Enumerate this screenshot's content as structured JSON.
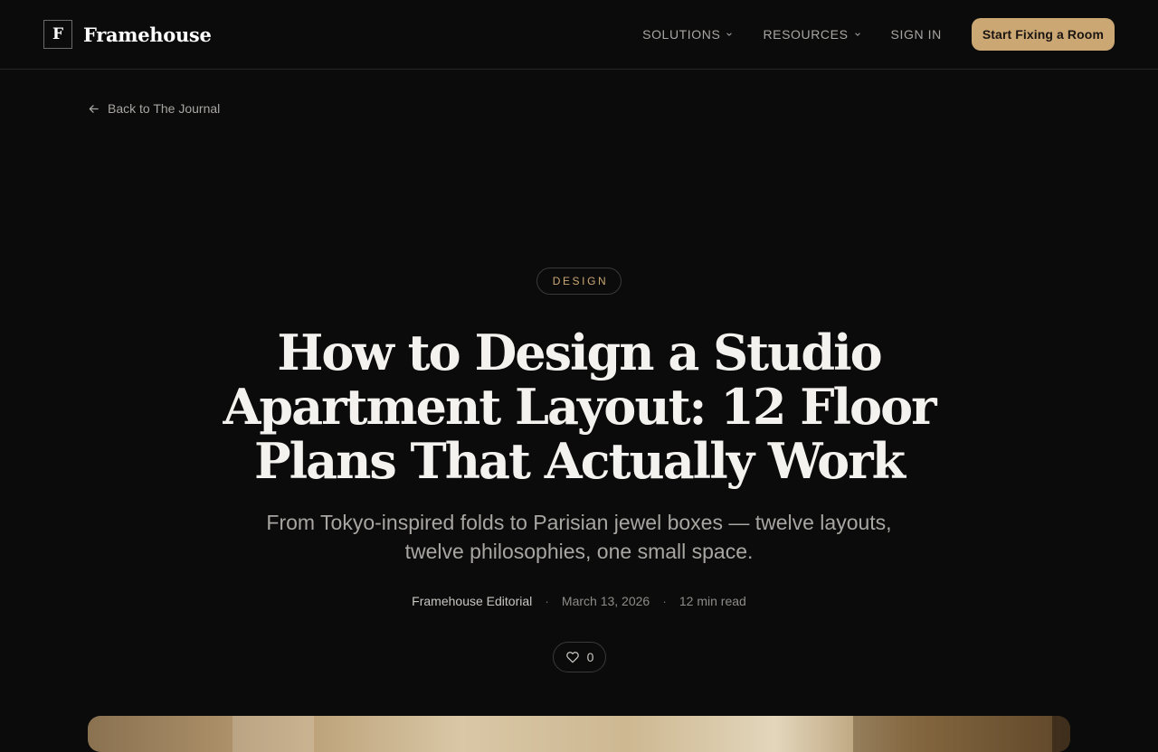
{
  "header": {
    "logo_mark": "F",
    "logo_text": "Framehouse",
    "nav": [
      {
        "label": "SOLUTIONS",
        "has_dropdown": true
      },
      {
        "label": "RESOURCES",
        "has_dropdown": true
      },
      {
        "label": "SIGN IN",
        "has_dropdown": false
      }
    ],
    "cta_label": "Start Fixing a Room"
  },
  "back_link": {
    "label": "Back to The Journal",
    "icon": "arrow-left-icon"
  },
  "article": {
    "category": "DESIGN",
    "title": "How to Design a Studio Apartment Layout: 12 Floor Plans That Actually Work",
    "subtitle": "From Tokyo-inspired folds to Parisian jewel boxes — twelve layouts, twelve philosophies, one small space.",
    "author": "Framehouse Editorial",
    "separator": "·",
    "date": "March 13, 2026",
    "read_time": "12 min read",
    "like_count": "0",
    "like_icon": "heart-icon"
  },
  "colors": {
    "background": "#0b0b0b",
    "accent": "#cba774",
    "text_primary": "#f4f2ee",
    "text_muted": "#a8a6a2",
    "border": "#3a3a3a"
  }
}
